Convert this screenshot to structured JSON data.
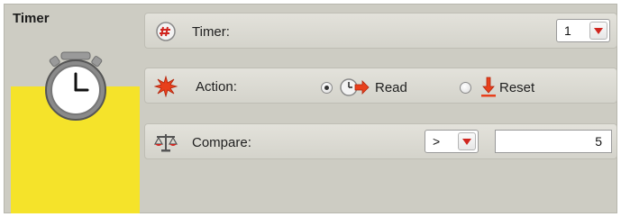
{
  "block": {
    "title": "Timer",
    "icon": "stopwatch-icon",
    "accent_color": "#f5e32a"
  },
  "rows": {
    "timer": {
      "icon": "timer-hash-icon",
      "label": "Timer:",
      "selected": "1"
    },
    "action": {
      "icon": "starburst-icon",
      "label": "Action:",
      "options": [
        {
          "icon": "read-timer-icon",
          "label": "Read",
          "checked": true
        },
        {
          "icon": "reset-arrow-icon",
          "label": "Reset",
          "checked": false
        }
      ]
    },
    "compare": {
      "icon": "scales-icon",
      "label": "Compare:",
      "operator": ">",
      "value": "5"
    }
  }
}
